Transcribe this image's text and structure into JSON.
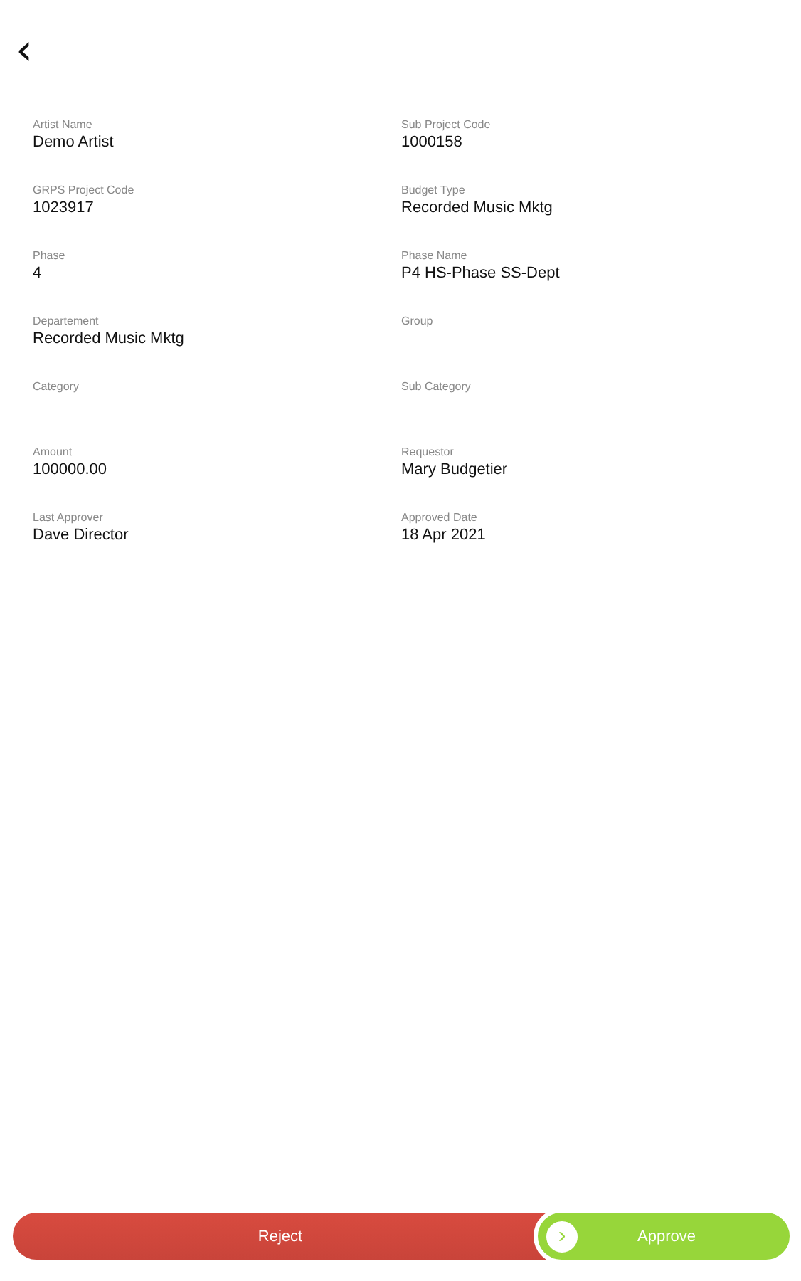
{
  "back_button": "‹",
  "fields": [
    {
      "label": "Artist Name",
      "value": "Demo Artist"
    },
    {
      "label": "Sub Project Code",
      "value": "1000158"
    },
    {
      "label": "GRPS Project Code",
      "value": "1023917"
    },
    {
      "label": "Budget Type",
      "value": "Recorded Music Mktg"
    },
    {
      "label": "Phase",
      "value": "4"
    },
    {
      "label": "Phase Name",
      "value": "P4 HS-Phase SS-Dept"
    },
    {
      "label": "Departement",
      "value": "Recorded Music Mktg"
    },
    {
      "label": "Group"
    },
    {
      "label": "Category"
    },
    {
      "label": "Sub Category"
    },
    {
      "label": "Amount",
      "value": "100000.00"
    },
    {
      "label": "Requestor",
      "value": "Mary Budgetier"
    },
    {
      "label": "Last Approver",
      "value": "Dave Director"
    },
    {
      "label": "Approved Date",
      "value": "18 Apr 2021"
    }
  ],
  "actions": {
    "reject": "Reject",
    "approve": "Approve",
    "slider_thumb": "›",
    "level": 0
  }
}
